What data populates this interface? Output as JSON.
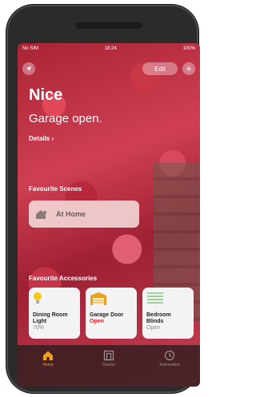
{
  "status_bar": {
    "carrier": "No SIM",
    "time": "18:24",
    "battery": "100%"
  },
  "header": {
    "edit_label": "Edit",
    "add_label": "+"
  },
  "home": {
    "title": "Nice",
    "status": "Garage open.",
    "details_label": "Details ›"
  },
  "scenes": {
    "section_label": "Favourite Scenes",
    "items": [
      {
        "label": "At Home",
        "icon": "house-person-icon"
      }
    ]
  },
  "accessories": {
    "section_label": "Favourite Accessories",
    "items": [
      {
        "name": "Dining Room Light",
        "state": "70%",
        "icon": "lightbulb-icon",
        "alert": false
      },
      {
        "name": "Garage Door",
        "state": "Open",
        "icon": "garage-door-icon",
        "alert": true
      },
      {
        "name": "Bedroom Blinds",
        "state": "Open",
        "icon": "blinds-icon",
        "alert": false
      }
    ]
  },
  "tabbar": {
    "tabs": [
      {
        "label": "Home",
        "icon": "house-icon",
        "active": true
      },
      {
        "label": "Rooms",
        "icon": "rooms-icon",
        "active": false
      },
      {
        "label": "Automation",
        "icon": "clock-icon",
        "active": false
      }
    ]
  },
  "colors": {
    "accent": "#f0a020",
    "alert": "#e0202a"
  }
}
